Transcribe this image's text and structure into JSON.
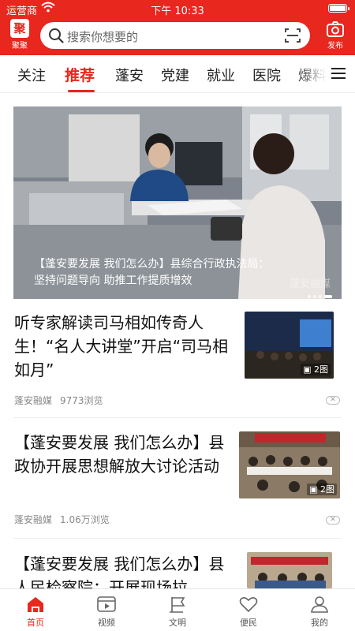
{
  "status_bar": {
    "carrier": "运营商",
    "time": "下午 10:33"
  },
  "header": {
    "logo_label": "聚聚",
    "search_placeholder": "搜索你想要的",
    "publish_label": "发布",
    "accent_color": "#e8271e"
  },
  "tabs": [
    {
      "label": "关注",
      "active": false
    },
    {
      "label": "推荐",
      "active": true
    },
    {
      "label": "蓬安",
      "active": false
    },
    {
      "label": "党建",
      "active": false
    },
    {
      "label": "就业",
      "active": false
    },
    {
      "label": "医院",
      "active": false
    },
    {
      "label": "爆料",
      "active": false
    }
  ],
  "hero": {
    "caption": "【蓬安要发展 我们怎么办】县综合行政执法局：坚持问题导向 助推工作提质增效",
    "watermark": "蓬安融媒"
  },
  "news": [
    {
      "title": "听专家解读司马相如传奇人生！“名人大讲堂”开启“司马相如月”",
      "source": "蓬安融媒",
      "views": "9773浏览",
      "image_count": "2图"
    },
    {
      "title": "【蓬安要发展 我们怎么办】县政协开展思想解放大讨论活动",
      "source": "蓬安融媒",
      "views": "1.06万浏览",
      "image_count": "2图"
    },
    {
      "title": "【蓬安要发展 我们怎么办】县人民检察院：开展现场拉",
      "source": "",
      "views": "",
      "image_count": ""
    }
  ],
  "bottom_nav": [
    {
      "label": "首页",
      "icon": "home-icon",
      "active": true
    },
    {
      "label": "视频",
      "icon": "video-icon",
      "active": false
    },
    {
      "label": "文明",
      "icon": "flag-icon",
      "active": false
    },
    {
      "label": "便民",
      "icon": "heart-icon",
      "active": false
    },
    {
      "label": "我的",
      "icon": "user-icon",
      "active": false
    }
  ]
}
